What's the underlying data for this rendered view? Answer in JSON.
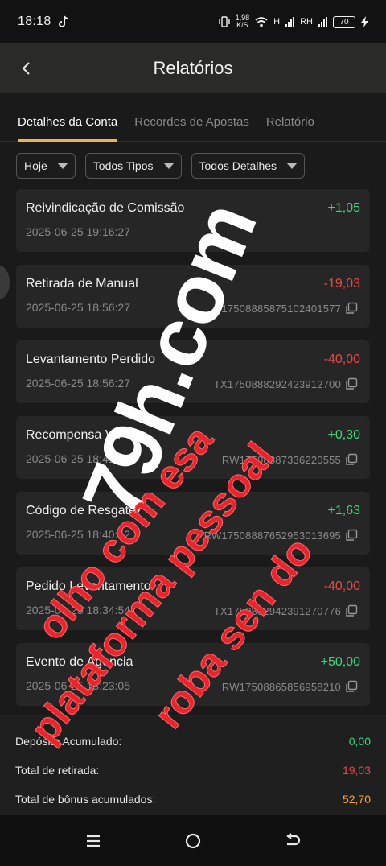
{
  "status_bar": {
    "time": "18:18",
    "speed_value": "1,98",
    "speed_unit": "K/S",
    "network_1": "H",
    "network_2": "RH",
    "battery": "70"
  },
  "header": {
    "title": "Relatórios"
  },
  "tabs": [
    {
      "label": "Detalhes da Conta",
      "active": true
    },
    {
      "label": "Recordes de Apostas",
      "active": false
    },
    {
      "label": "Relatório",
      "active": false
    }
  ],
  "filters": [
    {
      "label": "Hoje"
    },
    {
      "label": "Todos Tipos"
    },
    {
      "label": "Todos Detalhes"
    }
  ],
  "transactions": [
    {
      "title": "Reivindicação de Comissão",
      "amount": "+1,05",
      "sign": "pos",
      "date": "2025-06-25 19:16:27",
      "ref": ""
    },
    {
      "title": "Retirada de Manual",
      "amount": "-19,03",
      "sign": "neg",
      "date": "2025-06-25 18:56:27",
      "ref": "R17508885875102401577"
    },
    {
      "title": "Levantamento Perdido",
      "amount": "-40,00",
      "sign": "neg",
      "date": "2025-06-25 18:56:27",
      "ref": "TX1750888292423912700"
    },
    {
      "title": "Recompensa VIP",
      "amount": "+0,30",
      "sign": "pos",
      "date": "2025-06-25 18:41:13",
      "ref": "RW17508887336220555"
    },
    {
      "title": "Código de Resgate",
      "amount": "+1,63",
      "sign": "pos",
      "date": "2025-06-25 18:40:52",
      "ref": "RW17508887652953013695"
    },
    {
      "title": "Pedido Levantamento",
      "amount": "-40,00",
      "sign": "neg",
      "date": "2025-06-25 18:34:54",
      "ref": "TX1750882942391270776"
    },
    {
      "title": "Evento de Agencia",
      "amount": "+50,00",
      "sign": "pos",
      "date": "2025-06-25 18:23:05",
      "ref": "RW17508865856958210"
    }
  ],
  "summary": {
    "deposit_label": "Depósito Acumulado:",
    "deposit_value": "0,00",
    "withdraw_label": "Total de retirada:",
    "withdraw_value": "19,03",
    "bonus_label": "Total de bônus acumulados:",
    "bonus_value": "52,70"
  },
  "watermark": {
    "white": "79h.com",
    "red_line_1": "olho com esa",
    "red_line_2": "plataforma pessoal",
    "red_line_3": "roba sen do"
  },
  "colors": {
    "positive": "#3fd37a",
    "negative": "#e84848",
    "bonus": "#f0a838",
    "tab_indicator": "#e8b84a"
  }
}
